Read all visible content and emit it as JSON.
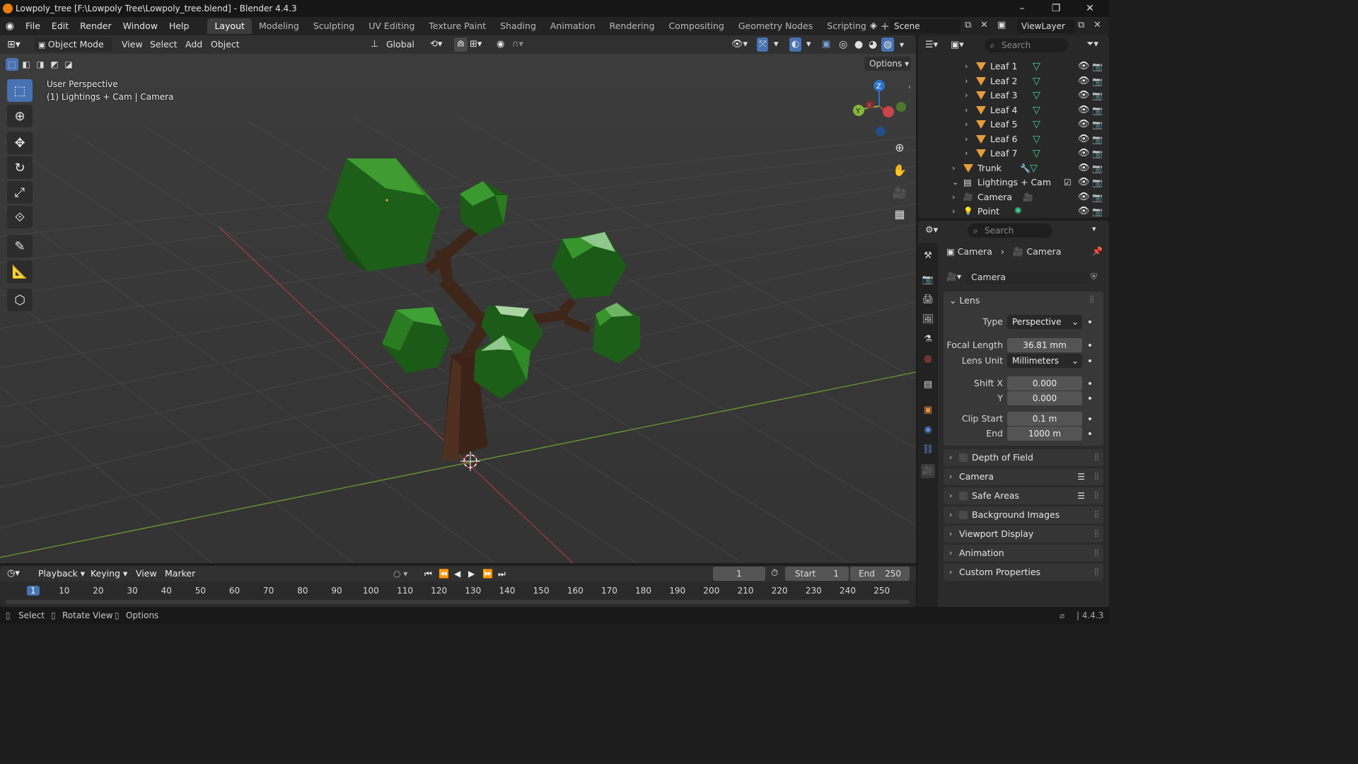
{
  "window": {
    "title": "Lowpoly_tree [F:\\Lowpoly Tree\\Lowpoly_tree.blend] - Blender 4.4.3",
    "controls": [
      "–",
      "❐",
      "✕"
    ]
  },
  "menu": [
    "File",
    "Edit",
    "Render",
    "Window",
    "Help"
  ],
  "workspaces": [
    "Layout",
    "Modeling",
    "Sculpting",
    "UV Editing",
    "Texture Paint",
    "Shading",
    "Animation",
    "Rendering",
    "Compositing",
    "Geometry Nodes",
    "Scripting"
  ],
  "workspace_add": "+",
  "scene": {
    "name": "Scene",
    "view_layer": "ViewLayer"
  },
  "viewport_header": {
    "mode": "Object Mode",
    "menus": [
      "View",
      "Select",
      "Add",
      "Object"
    ],
    "transform_orientation": "Global",
    "options_label": "Options"
  },
  "viewport": {
    "perspective": "User Perspective",
    "context": "(1) Lightings + Cam | Camera",
    "gizmo": {
      "z": "Z",
      "y": "Y",
      "x": "X"
    }
  },
  "outliner": {
    "search_placeholder": "Search",
    "rows": [
      {
        "name": "Leaf 1",
        "type": "mesh"
      },
      {
        "name": "Leaf 2",
        "type": "mesh"
      },
      {
        "name": "Leaf 3",
        "type": "mesh"
      },
      {
        "name": "Leaf 4",
        "type": "mesh"
      },
      {
        "name": "Leaf 5",
        "type": "mesh"
      },
      {
        "name": "Leaf 6",
        "type": "mesh"
      },
      {
        "name": "Leaf 7",
        "type": "mesh"
      },
      {
        "name": "Trunk",
        "type": "mesh"
      },
      {
        "name": "Lightings + Cam",
        "type": "collection"
      },
      {
        "name": "Camera",
        "type": "camera"
      },
      {
        "name": "Point",
        "type": "light"
      }
    ]
  },
  "properties": {
    "search_placeholder": "Search",
    "breadcrumb": [
      "Camera",
      "Camera"
    ],
    "datablock": "Camera",
    "lens_panel": {
      "title": "Lens",
      "type_label": "Type",
      "type_value": "Perspective",
      "focal_label": "Focal Length",
      "focal_value": "36.81 mm",
      "unit_label": "Lens Unit",
      "unit_value": "Millimeters",
      "shiftx_label": "Shift X",
      "shiftx_value": "0.000",
      "shifty_label": "Y",
      "shifty_value": "0.000",
      "clipstart_label": "Clip Start",
      "clipstart_value": "0.1 m",
      "clipend_label": "End",
      "clipend_value": "1000 m"
    },
    "collapsed_panels": [
      "Depth of Field",
      "Camera",
      "Safe Areas",
      "Background Images",
      "Viewport Display",
      "Animation",
      "Custom Properties"
    ]
  },
  "timeline": {
    "menus": [
      "Playback",
      "Keying",
      "View",
      "Marker"
    ],
    "current_frame": "1",
    "start_label": "Start",
    "start_value": "1",
    "end_label": "End",
    "end_value": "250",
    "ruler": [
      "1",
      "10",
      "20",
      "30",
      "40",
      "50",
      "60",
      "70",
      "80",
      "90",
      "100",
      "110",
      "120",
      "130",
      "140",
      "150",
      "160",
      "170",
      "180",
      "190",
      "200",
      "210",
      "220",
      "230",
      "240",
      "250"
    ]
  },
  "statusbar": {
    "hints": [
      "Select",
      "Rotate View",
      "Options"
    ],
    "version": "4.4.3"
  },
  "colors": {
    "accent": "#4772b3",
    "viewport_bg": "#393939",
    "leaf_green": "#1e6b1a",
    "trunk_brown": "#4a2e1e",
    "x_axis": "#b83434",
    "y_axis": "#7aa534"
  }
}
